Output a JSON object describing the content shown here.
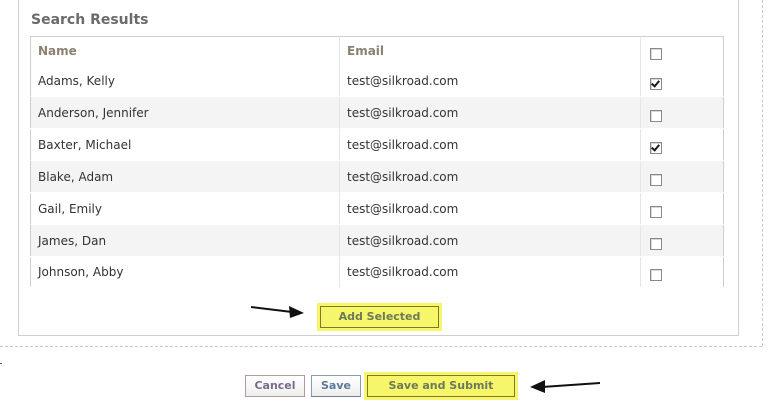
{
  "section_title": "Search Results",
  "table": {
    "headers": {
      "name": "Name",
      "email": "Email"
    },
    "rows": [
      {
        "name": "Adams, Kelly",
        "email": "test@silkroad.com",
        "checked": true
      },
      {
        "name": "Anderson, Jennifer",
        "email": "test@silkroad.com",
        "checked": false
      },
      {
        "name": "Baxter, Michael",
        "email": "test@silkroad.com",
        "checked": true
      },
      {
        "name": "Blake, Adam",
        "email": "test@silkroad.com",
        "checked": false
      },
      {
        "name": "Gail, Emily",
        "email": "test@silkroad.com",
        "checked": false
      },
      {
        "name": "James, Dan",
        "email": "test@silkroad.com",
        "checked": false
      },
      {
        "name": "Johnson, Abby",
        "email": "test@silkroad.com",
        "checked": false
      }
    ],
    "select_all_checked": false
  },
  "buttons": {
    "add_selected": "Add Selected",
    "cancel": "Cancel",
    "save": "Save",
    "save_and_submit": "Save and Submit"
  },
  "colors": {
    "highlight": "#f7f56a",
    "header_text": "#8c8070",
    "button_text": "#5a7a99"
  },
  "icons": {
    "arrow": "right-pointing-arrow",
    "arrow_left": "left-pointing-arrow"
  }
}
